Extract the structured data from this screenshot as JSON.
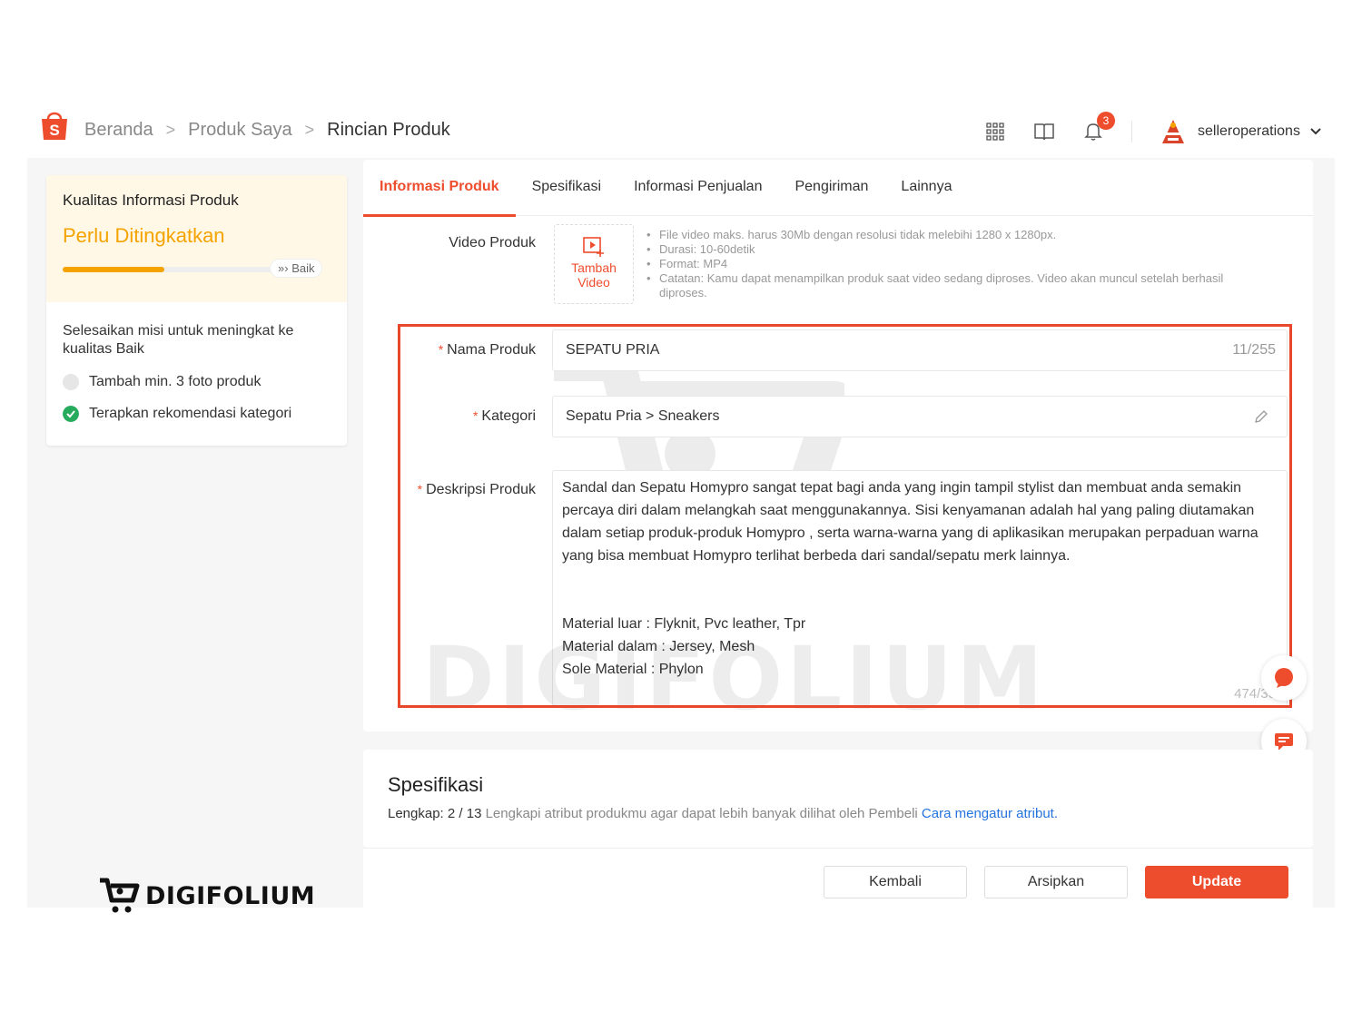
{
  "header": {
    "breadcrumb": [
      "Beranda",
      "Produk Saya",
      "Rincian Produk"
    ],
    "notification_count": "3",
    "username": "selleroperations"
  },
  "quality": {
    "title": "Kualitas Informasi Produk",
    "status": "Perlu Ditingkatkan",
    "progress": 0.43,
    "goal_label": "Baik",
    "mission": "Selesaikan misi untuk meningkat ke kualitas Baik",
    "tasks": [
      {
        "label": "Tambah min. 3 foto produk",
        "done": false
      },
      {
        "label": "Terapkan rekomendasi kategori",
        "done": true
      }
    ]
  },
  "tabs": [
    "Informasi Produk",
    "Spesifikasi",
    "Informasi Penjualan",
    "Pengiriman",
    "Lainnya"
  ],
  "form": {
    "video_label": "Video Produk",
    "video_button": [
      "Tambah",
      "Video"
    ],
    "video_notes": [
      "File video maks. harus 30Mb dengan resolusi tidak melebihi 1280 x 1280px.",
      "Durasi: 10-60detik",
      "Format: MP4",
      "Catatan: Kamu dapat menampilkan produk saat video sedang diproses. Video akan muncul setelah berhasil diproses."
    ],
    "name_label": "Nama Produk",
    "name_value": "SEPATU PRIA",
    "name_count": "11/255",
    "category_label": "Kategori",
    "category_value": "Sepatu Pria > Sneakers",
    "desc_label": "Deskripsi Produk",
    "desc_lines": [
      "Sandal dan Sepatu Homypro sangat tepat bagi anda yang ingin tampil stylist dan membuat anda semakin",
      "percaya diri dalam melangkah saat menggunakannya. Sisi kenyamanan adalah hal yang paling diutamakan",
      "dalam setiap produk-produk Homypro , serta warna-warna yang di aplikasikan merupakan perpaduan warna",
      "yang bisa membuat Homypro terlihat berbeda dari sandal/sepatu merk lainnya.",
      "",
      "",
      "Material luar : Flyknit, Pvc leather, Tpr",
      "Material dalam : Jersey, Mesh",
      "Sole Material : Phylon"
    ],
    "desc_count": "474/30"
  },
  "spec": {
    "title": "Spesifikasi",
    "complete": "Lengkap: 2 / 13",
    "hint": "Lengkapi atribut produkmu agar dapat lebih banyak dilihat oleh Pembeli",
    "link": "Cara mengatur atribut."
  },
  "buttons": {
    "back": "Kembali",
    "archive": "Arsipkan",
    "update": "Update"
  },
  "watermark": "DIGIFOLIUM",
  "brand": "DIGIFOLIUM",
  "colors": {
    "accent": "#ee4d2d",
    "warning": "#f5a300",
    "success": "#26aa5b",
    "highlight_box": "#e8472c"
  }
}
